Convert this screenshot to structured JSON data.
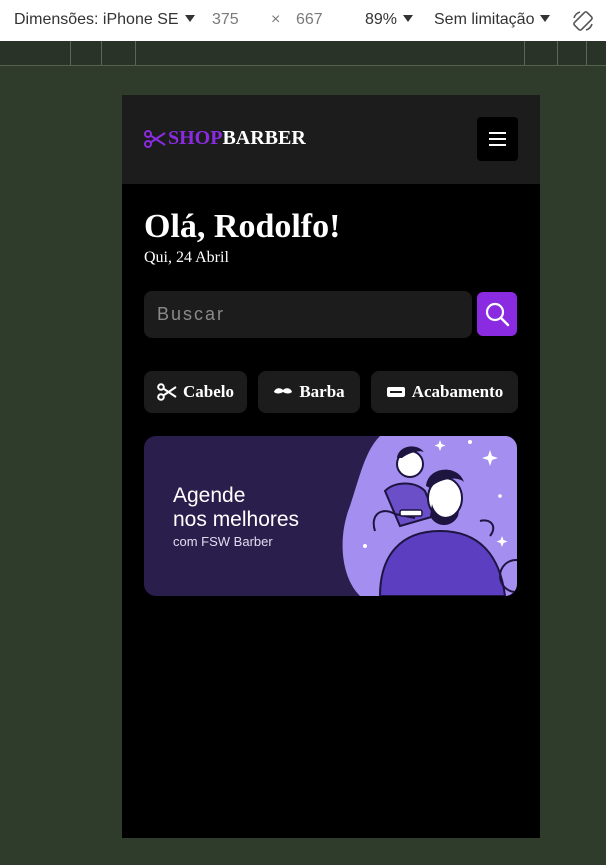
{
  "devtools": {
    "dimensions_label": "Dimensões: iPhone SE",
    "width": "375",
    "times": "×",
    "height": "667",
    "zoom": "89%",
    "throttle": "Sem limitação",
    "rotate_icon": "rotate-icon"
  },
  "app": {
    "logo_shop": "SHOP",
    "logo_barber": "BARBER",
    "brand_color": "#8a2be2",
    "greeting": "Olá, Rodolfo!",
    "date": "Qui, 24 Abril",
    "search": {
      "placeholder": "Buscar",
      "icon": "search-icon"
    },
    "categories": [
      {
        "label": "Cabelo",
        "icon": "scissors-icon"
      },
      {
        "label": "Barba",
        "icon": "mustache-icon"
      },
      {
        "label": "Acabamento",
        "icon": "razor-icon"
      }
    ],
    "banner": {
      "line1": "Agende",
      "line2": "nos melhores",
      "line3": "com FSW Barber"
    }
  }
}
